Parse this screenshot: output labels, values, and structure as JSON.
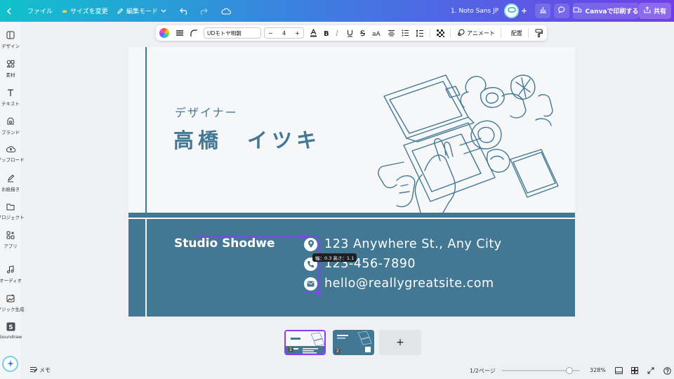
{
  "topbar": {
    "file": "ファイル",
    "resize": "サイズを変更",
    "edit_mode": "編集モード",
    "doc_title": "1. Noto Sans JP",
    "print": "Canvaで印刷する",
    "share": "共有"
  },
  "sidebar": {
    "items": [
      {
        "label": "デザイン",
        "icon": "layout-icon"
      },
      {
        "label": "素材",
        "icon": "elements-icon"
      },
      {
        "label": "テキスト",
        "icon": "text-icon"
      },
      {
        "label": "ブランド",
        "icon": "brand-icon"
      },
      {
        "label": "アップロード",
        "icon": "upload-icon"
      },
      {
        "label": "お絵描き",
        "icon": "draw-icon"
      },
      {
        "label": "プロジェクト",
        "icon": "folder-icon"
      },
      {
        "label": "アプリ",
        "icon": "apps-icon"
      },
      {
        "label": "オーディオ",
        "icon": "audio-icon"
      },
      {
        "label": "マジック生成",
        "icon": "magic-media-icon"
      },
      {
        "label": "Soundraw",
        "icon": "soundraw-icon"
      }
    ]
  },
  "text_toolbar": {
    "font": "UDモトヤ明朝",
    "size": "4",
    "minus": "−",
    "plus": "+",
    "animate": "アニメート",
    "position": "配置"
  },
  "card": {
    "role": "デザイナー",
    "name": "高橋　イツキ",
    "studio": "Studio Shodwe",
    "address": "123 Anywhere St., Any City",
    "phone": "123-456-7890",
    "email": "hello@reallygreatsite.com",
    "dimension_tip": "幅：0.3 高さ：1.1",
    "colors": {
      "primary": "#437894",
      "background": "#f6f7f9"
    }
  },
  "thumbnails": [
    {
      "page": "1",
      "selected": true
    },
    {
      "page": "2",
      "selected": false
    }
  ],
  "add_page": "+",
  "bottombar": {
    "memo": "メモ",
    "pages": "1/2ページ",
    "zoom": "328%"
  },
  "accent_color": "#8b3dff"
}
